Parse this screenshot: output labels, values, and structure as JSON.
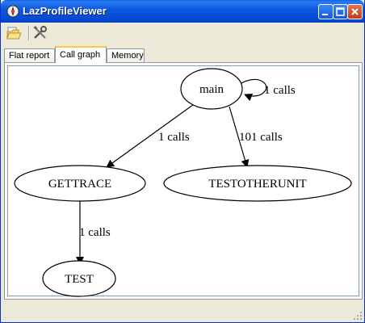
{
  "window": {
    "title": "LazProfileViewer"
  },
  "toolbar": {
    "open_icon": "open-folder-icon",
    "settings_icon": "tools-icon"
  },
  "tabs": [
    {
      "label": "Flat report",
      "active": false
    },
    {
      "label": "Call graph",
      "active": true
    },
    {
      "label": "Memory",
      "active": false
    }
  ],
  "graph": {
    "nodes": [
      {
        "id": "main",
        "label": "main"
      },
      {
        "id": "gettrace",
        "label": "GETTRACE"
      },
      {
        "id": "testotherunit",
        "label": "TESTOTHERUNIT"
      },
      {
        "id": "test",
        "label": "TEST"
      }
    ],
    "edges": [
      {
        "from": "main",
        "to": "main",
        "label": "1 calls"
      },
      {
        "from": "main",
        "to": "gettrace",
        "label": "1 calls"
      },
      {
        "from": "main",
        "to": "testotherunit",
        "label": "101 calls"
      },
      {
        "from": "gettrace",
        "to": "test",
        "label": "1 calls"
      }
    ]
  }
}
